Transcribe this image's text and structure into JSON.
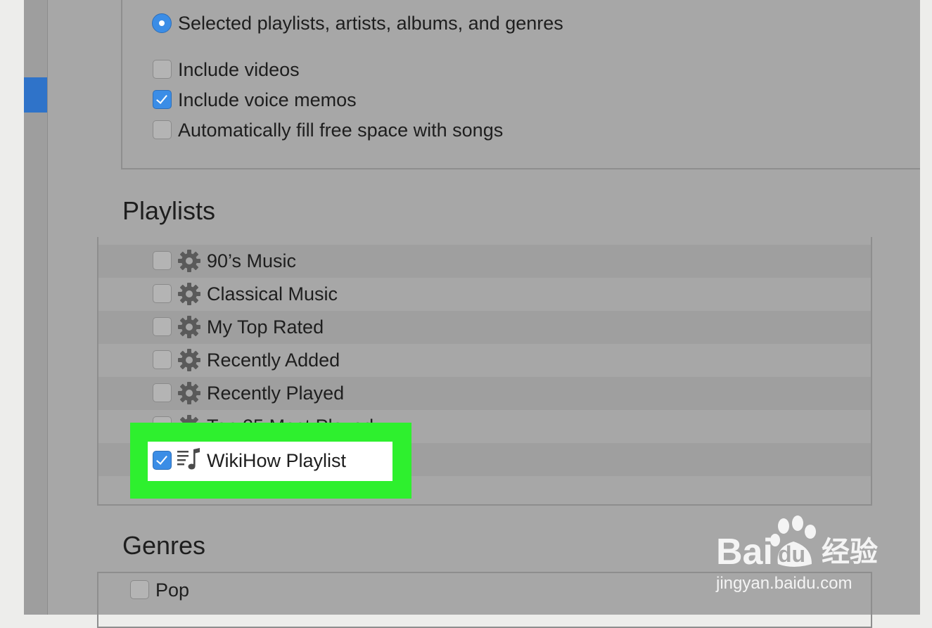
{
  "sync_options": {
    "radio_label": "Selected playlists, artists, albums, and genres",
    "include_videos": "Include videos",
    "include_voice_memos": "Include voice memos",
    "auto_fill": "Automatically fill free space with songs"
  },
  "playlists": {
    "heading": "Playlists",
    "items": [
      {
        "label": "90’s Music",
        "checked": false,
        "icon": "gear-icon"
      },
      {
        "label": "Classical Music",
        "checked": false,
        "icon": "gear-icon"
      },
      {
        "label": "My Top Rated",
        "checked": false,
        "icon": "gear-icon"
      },
      {
        "label": "Recently Added",
        "checked": false,
        "icon": "gear-icon"
      },
      {
        "label": "Recently Played",
        "checked": false,
        "icon": "gear-icon"
      },
      {
        "label": "Top 25 Most Played",
        "checked": false,
        "icon": "gear-icon"
      },
      {
        "label": "WikiHow Playlist",
        "checked": true,
        "icon": "playlist-icon"
      }
    ]
  },
  "genres": {
    "heading": "Genres",
    "items": [
      {
        "label": "Pop",
        "checked": false
      }
    ]
  },
  "watermark": {
    "brand": "Bai",
    "brand2": "du",
    "cn": "经验",
    "url": "jingyan.baidu.com"
  },
  "colors": {
    "accent": "#3b8de6",
    "highlight": "#2ef02e",
    "panel": "#a7a7a7"
  }
}
